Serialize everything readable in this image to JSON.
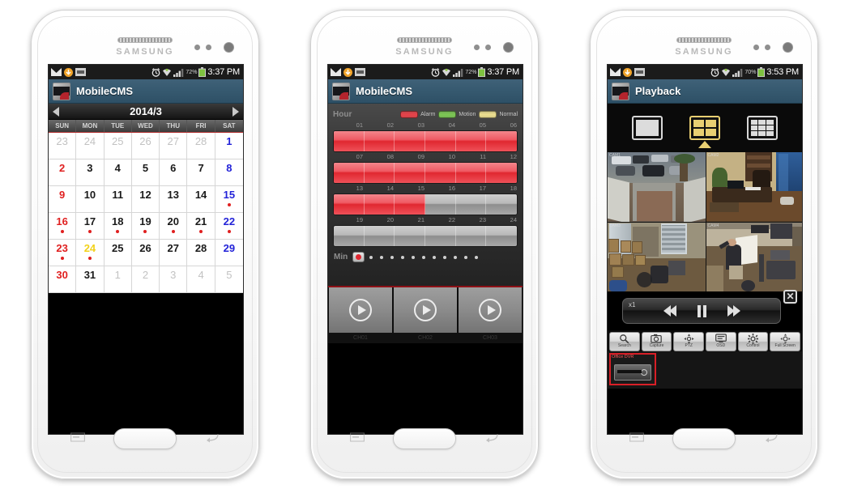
{
  "device": {
    "brand": "SAMSUNG"
  },
  "phones": [
    {
      "id": "phone-calendar",
      "status": {
        "battery_pct": "72%",
        "clock": "3:37 PM"
      },
      "app": {
        "title": "MobileCMS"
      },
      "calendar": {
        "month_label": "2014/3",
        "prev_label": "◀",
        "next_label": "▶",
        "weekdays": [
          "SUN",
          "MON",
          "TUE",
          "WED",
          "THU",
          "FRI",
          "SAT"
        ],
        "weeks": [
          [
            {
              "d": "23",
              "t": "other",
              "dot": false
            },
            {
              "d": "24",
              "t": "other",
              "dot": false
            },
            {
              "d": "25",
              "t": "other",
              "dot": false
            },
            {
              "d": "26",
              "t": "other",
              "dot": false
            },
            {
              "d": "27",
              "t": "other",
              "dot": false
            },
            {
              "d": "28",
              "t": "other",
              "dot": false
            },
            {
              "d": "1",
              "t": "sat",
              "dot": false
            }
          ],
          [
            {
              "d": "2",
              "t": "sun",
              "dot": false
            },
            {
              "d": "3",
              "t": "wk",
              "dot": false
            },
            {
              "d": "4",
              "t": "wk",
              "dot": false
            },
            {
              "d": "5",
              "t": "wk",
              "dot": false
            },
            {
              "d": "6",
              "t": "wk",
              "dot": false
            },
            {
              "d": "7",
              "t": "wk",
              "dot": false
            },
            {
              "d": "8",
              "t": "sat",
              "dot": false
            }
          ],
          [
            {
              "d": "9",
              "t": "sun",
              "dot": false
            },
            {
              "d": "10",
              "t": "wk",
              "dot": false
            },
            {
              "d": "11",
              "t": "wk",
              "dot": false
            },
            {
              "d": "12",
              "t": "wk",
              "dot": false
            },
            {
              "d": "13",
              "t": "wk",
              "dot": false
            },
            {
              "d": "14",
              "t": "wk",
              "dot": false
            },
            {
              "d": "15",
              "t": "sat",
              "dot": true
            }
          ],
          [
            {
              "d": "16",
              "t": "sun",
              "dot": true
            },
            {
              "d": "17",
              "t": "wk",
              "dot": true
            },
            {
              "d": "18",
              "t": "wk",
              "dot": true
            },
            {
              "d": "19",
              "t": "wk",
              "dot": true
            },
            {
              "d": "20",
              "t": "wk",
              "dot": true
            },
            {
              "d": "21",
              "t": "wk",
              "dot": true
            },
            {
              "d": "22",
              "t": "sat",
              "dot": true
            }
          ],
          [
            {
              "d": "23",
              "t": "sun",
              "dot": true
            },
            {
              "d": "24",
              "t": "sel",
              "dot": true
            },
            {
              "d": "25",
              "t": "wk",
              "dot": false
            },
            {
              "d": "26",
              "t": "wk",
              "dot": false
            },
            {
              "d": "27",
              "t": "wk",
              "dot": false
            },
            {
              "d": "28",
              "t": "wk",
              "dot": false
            },
            {
              "d": "29",
              "t": "sat",
              "dot": false
            }
          ],
          [
            {
              "d": "30",
              "t": "sun",
              "dot": false
            },
            {
              "d": "31",
              "t": "wk",
              "dot": false
            },
            {
              "d": "1",
              "t": "other",
              "dot": false
            },
            {
              "d": "2",
              "t": "other",
              "dot": false
            },
            {
              "d": "3",
              "t": "other",
              "dot": false
            },
            {
              "d": "4",
              "t": "other",
              "dot": false
            },
            {
              "d": "5",
              "t": "other",
              "dot": false
            }
          ]
        ]
      }
    },
    {
      "id": "phone-timeline",
      "status": {
        "battery_pct": "72%",
        "clock": "3:37 PM"
      },
      "app": {
        "title": "MobileCMS"
      },
      "timeline": {
        "hour_label": "Hour",
        "min_label": "Min",
        "legend": [
          {
            "name": "Alarm",
            "color": "#e8434a"
          },
          {
            "name": "Motion",
            "color": "#7dc855"
          },
          {
            "name": "Normal",
            "color": "#ede090"
          }
        ],
        "rows": [
          {
            "ticks": [
              "01",
              "02",
              "03",
              "04",
              "05",
              "06"
            ],
            "fill": [
              1,
              1,
              1,
              1,
              1,
              1
            ]
          },
          {
            "ticks": [
              "07",
              "08",
              "09",
              "10",
              "11",
              "12"
            ],
            "fill": [
              1,
              1,
              1,
              1,
              1,
              1
            ]
          },
          {
            "ticks": [
              "13",
              "14",
              "15",
              "16",
              "17",
              "18"
            ],
            "fill": [
              1,
              1,
              1,
              0,
              0,
              0
            ]
          },
          {
            "ticks": [
              "19",
              "20",
              "21",
              "22",
              "23",
              "24"
            ],
            "fill": [
              0,
              0,
              0,
              0,
              0,
              0
            ]
          }
        ],
        "min_dot_count": 11,
        "channels": [
          "CH01",
          "CH02",
          "CH03"
        ]
      }
    },
    {
      "id": "phone-playback",
      "status": {
        "battery_pct": "70%",
        "clock": "3:53 PM"
      },
      "app": {
        "title": "Playback"
      },
      "playback": {
        "layouts": [
          {
            "name": "1-up",
            "cells": 1,
            "selected": false
          },
          {
            "name": "4-up",
            "cells": 4,
            "selected": true
          },
          {
            "name": "9-up",
            "cells": 9,
            "selected": false
          }
        ],
        "cameras": [
          {
            "label": "CAM1",
            "scene": "parking-lot"
          },
          {
            "label": "CAM2",
            "scene": "office"
          },
          {
            "label": "CAM3",
            "scene": "warehouse"
          },
          {
            "label": "CAM4",
            "scene": "workshop"
          }
        ],
        "controls": {
          "speed": "x1",
          "rewind_label": "◀◀",
          "pause_label": "❙❙",
          "forward_label": "▶▶",
          "close_label": "✕"
        },
        "toolbar": [
          {
            "label": "Search",
            "icon": "magnifier-icon"
          },
          {
            "label": "Capture",
            "icon": "camera-icon"
          },
          {
            "label": "PTZ",
            "icon": "pan-tilt-icon"
          },
          {
            "label": "OSD",
            "icon": "monitor-icon"
          },
          {
            "label": "Control",
            "icon": "gear-icon"
          },
          {
            "label": "Full Screen",
            "icon": "expand-icon"
          }
        ],
        "device": {
          "name": "Office DVR"
        }
      }
    }
  ]
}
